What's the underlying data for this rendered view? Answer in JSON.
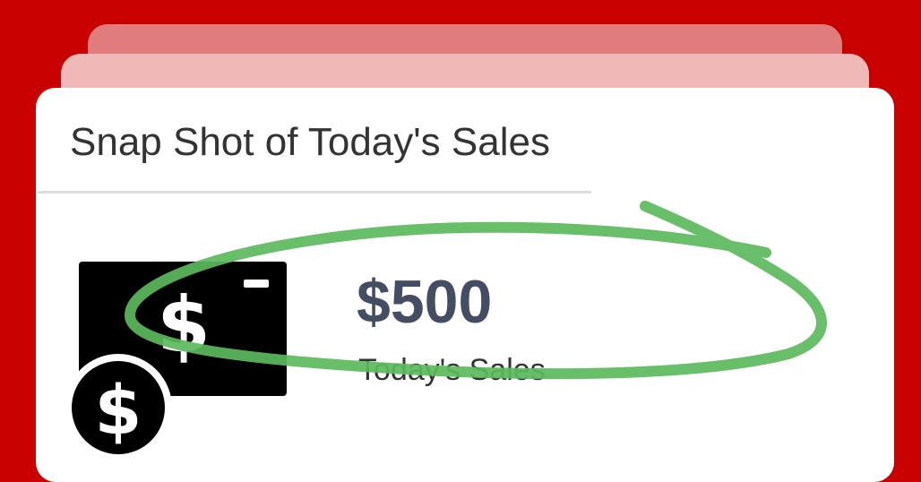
{
  "card": {
    "title": "Snap Shot of Today's Sales",
    "sales_value": "$500",
    "sales_label": "Today's Sales",
    "icon": "money-bill-dollar-icon"
  },
  "annotation": {
    "color": "#5cb85c"
  },
  "colors": {
    "background": "#c80000",
    "value_text": "#444d63"
  }
}
